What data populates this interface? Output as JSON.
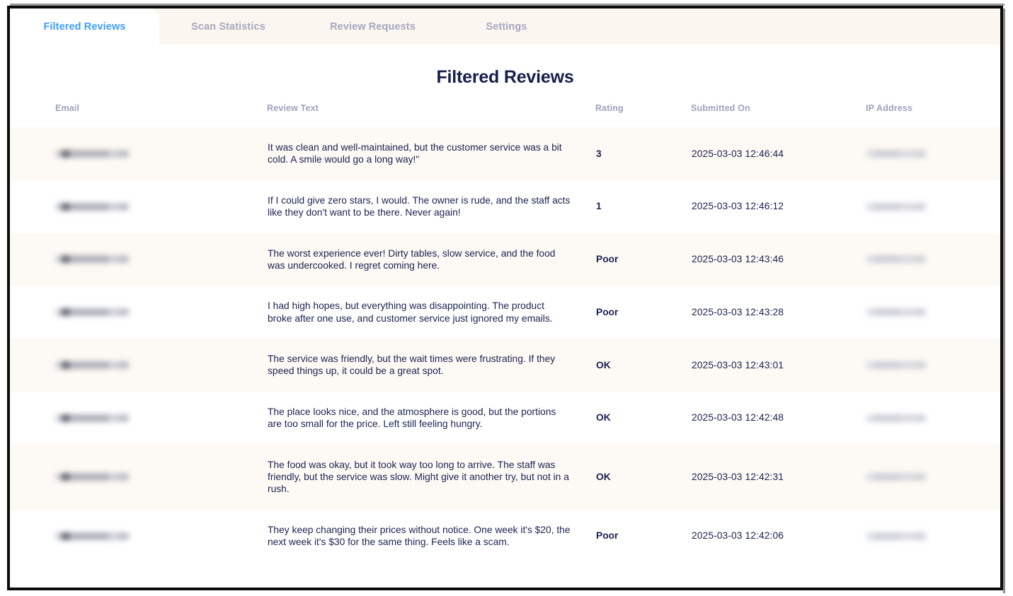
{
  "tabs": [
    {
      "label": "Filtered Reviews",
      "active": true
    },
    {
      "label": "Scan Statistics",
      "active": false
    },
    {
      "label": "Review Requests",
      "active": false
    },
    {
      "label": "Settings",
      "active": false
    }
  ],
  "page": {
    "title": "Filtered Reviews"
  },
  "table": {
    "columns": [
      "Email",
      "Review Text",
      "Rating",
      "Submitted On",
      "IP Address"
    ],
    "rows": [
      {
        "email": "redacted",
        "review": "It was clean and well-maintained, but the customer service was a bit cold. A smile would go a long way!\"",
        "rating": "3",
        "submitted_on": "2025-03-03 12:46:44",
        "ip": "redacted"
      },
      {
        "email": "redacted",
        "review": "If I could give zero stars, I would. The owner is rude, and the staff acts like they don't want to be there. Never again!",
        "rating": "1",
        "submitted_on": "2025-03-03 12:46:12",
        "ip": "redacted"
      },
      {
        "email": "redacted",
        "review": "The worst experience ever! Dirty tables, slow service, and the food was undercooked. I regret coming here.",
        "rating": "Poor",
        "submitted_on": "2025-03-03 12:43:46",
        "ip": "redacted"
      },
      {
        "email": "redacted",
        "review": "I had high hopes, but everything was disappointing. The product broke after one use, and customer service just ignored my emails.",
        "rating": "Poor",
        "submitted_on": "2025-03-03 12:43:28",
        "ip": "redacted"
      },
      {
        "email": "redacted",
        "review": "The service was friendly, but the wait times were frustrating. If they speed things up, it could be a great spot.",
        "rating": "OK",
        "submitted_on": "2025-03-03 12:43:01",
        "ip": "redacted"
      },
      {
        "email": "redacted",
        "review": "The place looks nice, and the atmosphere is good, but the portions are too small for the price. Left still feeling hungry.",
        "rating": "OK",
        "submitted_on": "2025-03-03 12:42:48",
        "ip": "redacted"
      },
      {
        "email": "redacted",
        "review": "The food was okay, but it took way too long to arrive. The staff was friendly, but the service was slow. Might give it another try, but not in a rush.",
        "rating": "OK",
        "submitted_on": "2025-03-03 12:42:31",
        "ip": "redacted"
      },
      {
        "email": "redacted",
        "review": "They keep changing their prices without notice. One week it's $20, the next week it's $30 for the same thing. Feels like a scam.",
        "rating": "Poor",
        "submitted_on": "2025-03-03 12:42:06",
        "ip": "redacted"
      }
    ]
  },
  "colors": {
    "accent": "#3b9dfb",
    "title": "#161f48",
    "tab_inactive": "#a6a8c0",
    "tabbar_bg": "#fbf6f0",
    "row_alt_bg": "#fdf9f4",
    "header_text": "#9fa2bd",
    "date_text": "#b6b9cd",
    "body_text": "#1b2350"
  }
}
